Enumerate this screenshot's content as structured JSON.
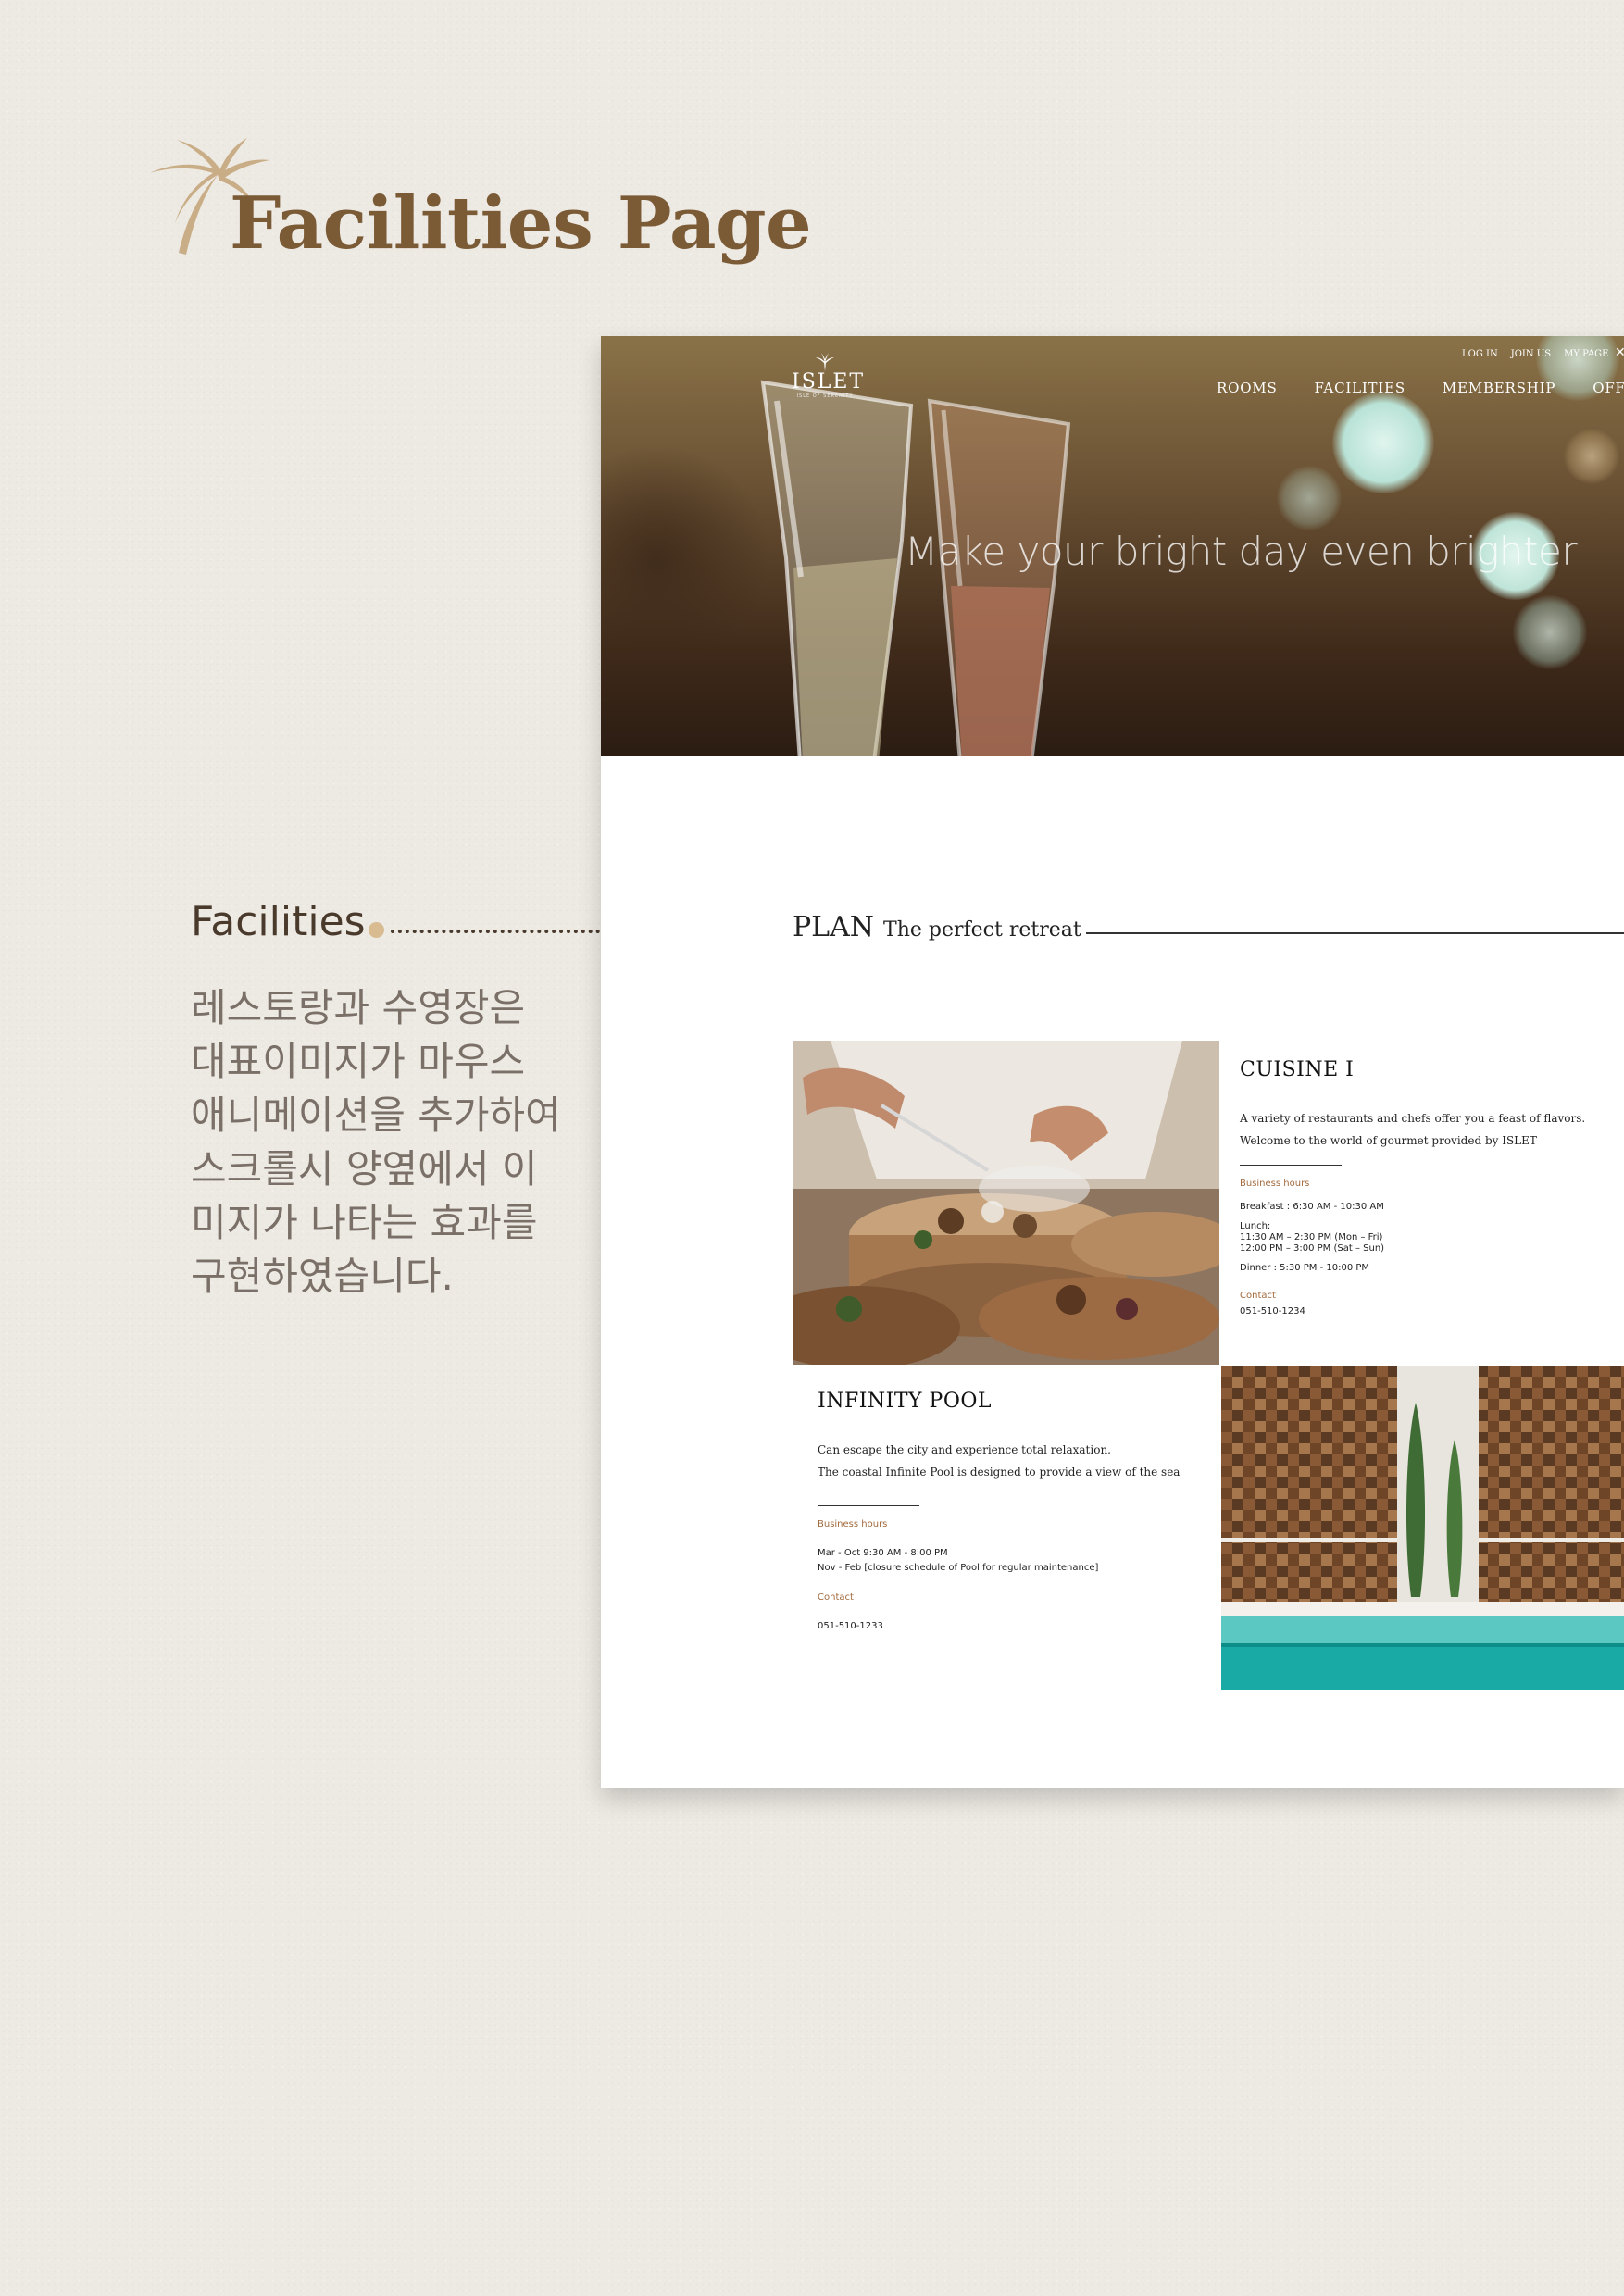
{
  "presentation": {
    "title": "Facilities Page",
    "logo_icon": "palm-leaf-icon",
    "brand_color": "#7b5a36"
  },
  "annotation": {
    "heading": "Facilities",
    "lines": [
      "레스토랑과 수영장은",
      "대표이미지가 마우스",
      "애니메이션을 추가하여",
      "스크롤시 양옆에서 이",
      "미지가 나타는 효과를",
      "구현하였습니다."
    ]
  },
  "site": {
    "logo_text": "ISLET",
    "logo_sub": "ISLE OF SERENITY",
    "util_nav": [
      "LOG IN",
      "JOIN US",
      "MY PAGE"
    ],
    "main_nav": [
      "ROOMS",
      "FACILITIES",
      "MEMBERSHIP",
      "OFFERS"
    ],
    "hero_tagline": "Make your bright day even brighter",
    "plan_word": "PLAN",
    "plan_sub": "The perfect retreat",
    "cuisine": {
      "title": "CUISINE I",
      "desc_1": "A variety of restaurants and chefs offer you a feast of flavors.",
      "desc_2": "Welcome to the world of gourmet provided by ISLET",
      "hours_label": "Business hours",
      "hours": [
        "Breakfast : 6:30 AM - 10:30 AM",
        "Lunch:",
        "11:30 AM – 2:30 PM (Mon – Fri)",
        "12:00 PM – 3:00 PM (Sat – Sun)",
        "Dinner : 5:30 PM - 10:00 PM"
      ],
      "contact_label": "Contact",
      "contact": "051-510-1234"
    },
    "pool": {
      "title": "INFINITY POOL",
      "desc_1": "Can escape the city and experience total relaxation.",
      "desc_2": "The coastal Infinite Pool is designed to provide a view of the sea",
      "hours_label": "Business hours",
      "hours": [
        "Mar - Oct 9:30 AM - 8:00 PM",
        "Nov - Feb [closure schedule of Pool for regular maintenance]"
      ],
      "contact_label": "Contact",
      "contact": "051-510-1233"
    },
    "accent_color": "#a26a3d"
  }
}
